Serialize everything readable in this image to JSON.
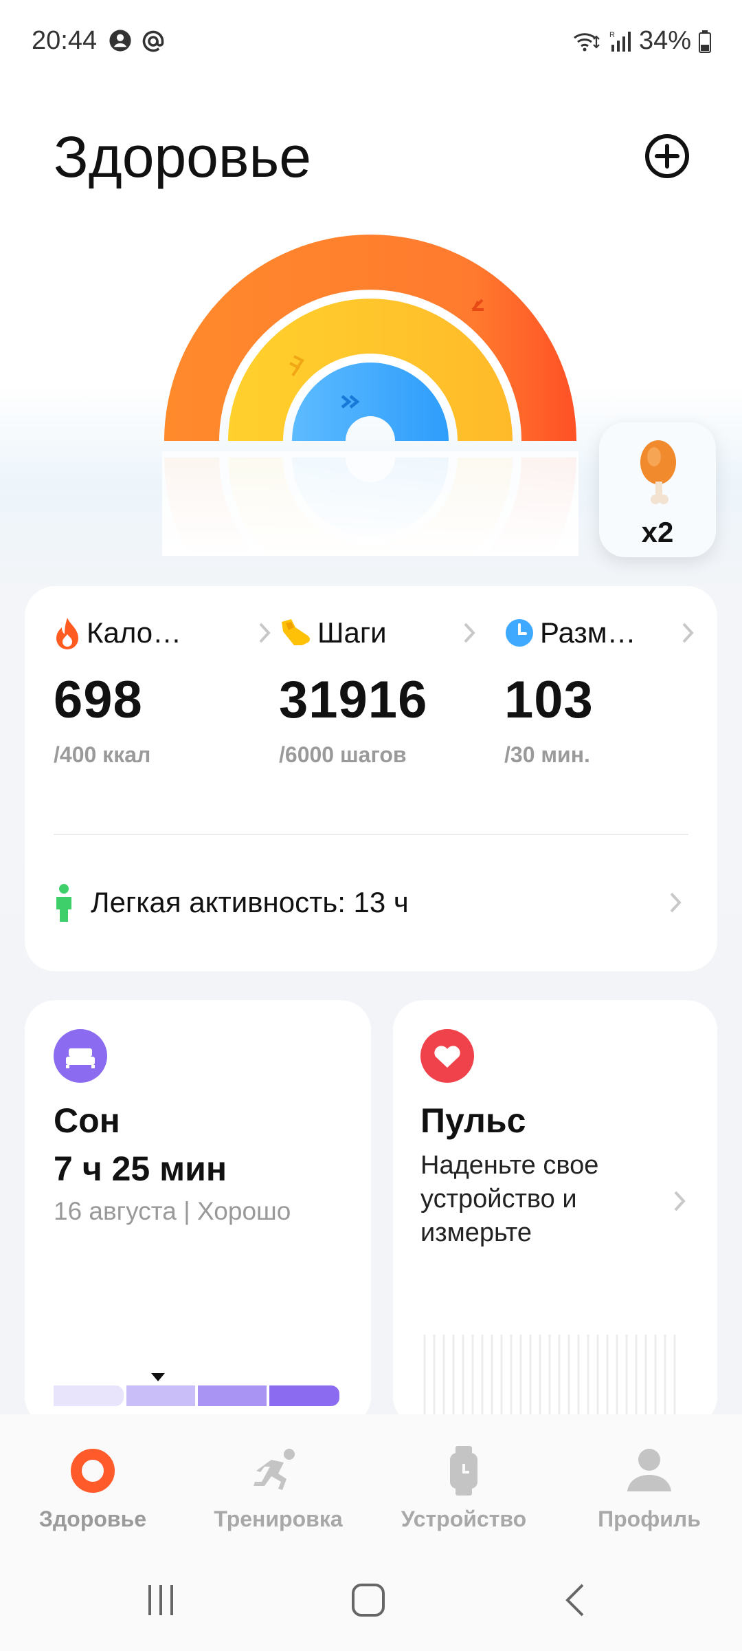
{
  "status_bar": {
    "time": "20:44",
    "battery": "34%"
  },
  "header": {
    "title": "Здоровье"
  },
  "reward": {
    "count": "x2",
    "icon": "drumstick-icon"
  },
  "activity_rings": {
    "calories_progress": 1.0,
    "steps_progress": 1.0,
    "moving_progress": 1.0,
    "colors": {
      "outer": "#ff7a2e",
      "middle": "#ffc12b",
      "inner": "#3fa9ff"
    }
  },
  "summary": {
    "metrics": [
      {
        "label": "Кало…",
        "value": "698",
        "goal": "/400 ккал",
        "icon": "flame-icon",
        "color": "#ff5a1f"
      },
      {
        "label": "Шаги",
        "value": "31916",
        "goal": "/6000 шагов",
        "icon": "shoe-icon",
        "color": "#ffc107"
      },
      {
        "label": "Разм…",
        "value": "103",
        "goal": "/30 мин.",
        "icon": "clock-icon",
        "color": "#3fa9ff"
      }
    ],
    "light_activity": "Легкая активность: 13 ч"
  },
  "sleep": {
    "title": "Сон",
    "value": "7 ч 25 мин",
    "subtitle": "16 августа | Хорошо",
    "icon_color": "#8b6cf0"
  },
  "pulse": {
    "title": "Пульс",
    "message": "Наденьте свое устройство и измерьте",
    "icon_color": "#f0424a"
  },
  "bottom_nav": {
    "items": [
      {
        "label": "Здоровье",
        "active": true
      },
      {
        "label": "Тренировка",
        "active": false
      },
      {
        "label": "Устройство",
        "active": false
      },
      {
        "label": "Профиль",
        "active": false
      }
    ]
  }
}
